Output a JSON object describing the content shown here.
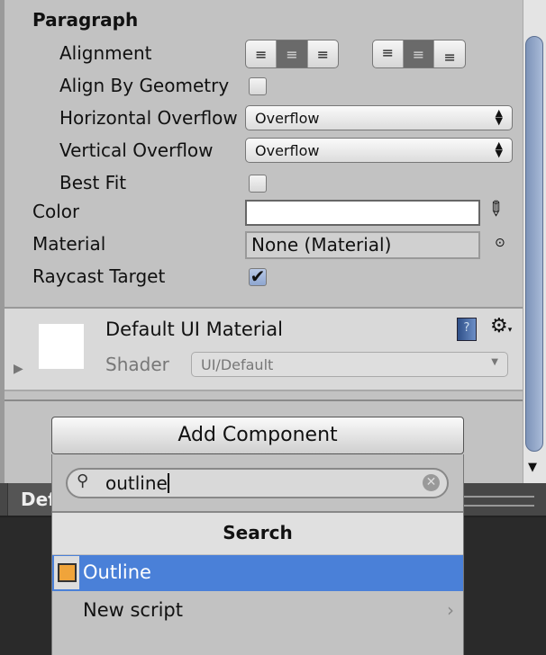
{
  "paragraph": {
    "title": "Paragraph",
    "alignment_label": "Alignment",
    "horizontal_alignment": [
      "left",
      "center",
      "right"
    ],
    "horizontal_selected": "center",
    "vertical_alignment": [
      "top",
      "middle",
      "bottom"
    ],
    "vertical_selected": "middle",
    "align_by_geometry_label": "Align By Geometry",
    "align_by_geometry": false,
    "horizontal_overflow_label": "Horizontal Overflow",
    "horizontal_overflow": "Overflow",
    "vertical_overflow_label": "Vertical Overflow",
    "vertical_overflow": "Overflow",
    "best_fit_label": "Best Fit",
    "best_fit": false
  },
  "color_label": "Color",
  "color_value": "#ffffff",
  "material_label": "Material",
  "material_value": "None (Material)",
  "raycast_label": "Raycast Target",
  "raycast_target": true,
  "material_section": {
    "name": "Default UI Material",
    "shader_label": "Shader",
    "shader_value": "UI/Default"
  },
  "add_component": {
    "label": "Add Component",
    "search_value": "outline",
    "header": "Search",
    "results": [
      {
        "label": "Outline",
        "icon": "script-icon",
        "selected": true
      }
    ],
    "new_script_label": "New script"
  },
  "bottom_panel": {
    "tab_label": "Def"
  },
  "colors": {
    "selection": "#4a80d8",
    "background": "#c2c2c2",
    "scroll_thumb": "#8ea3c4"
  }
}
